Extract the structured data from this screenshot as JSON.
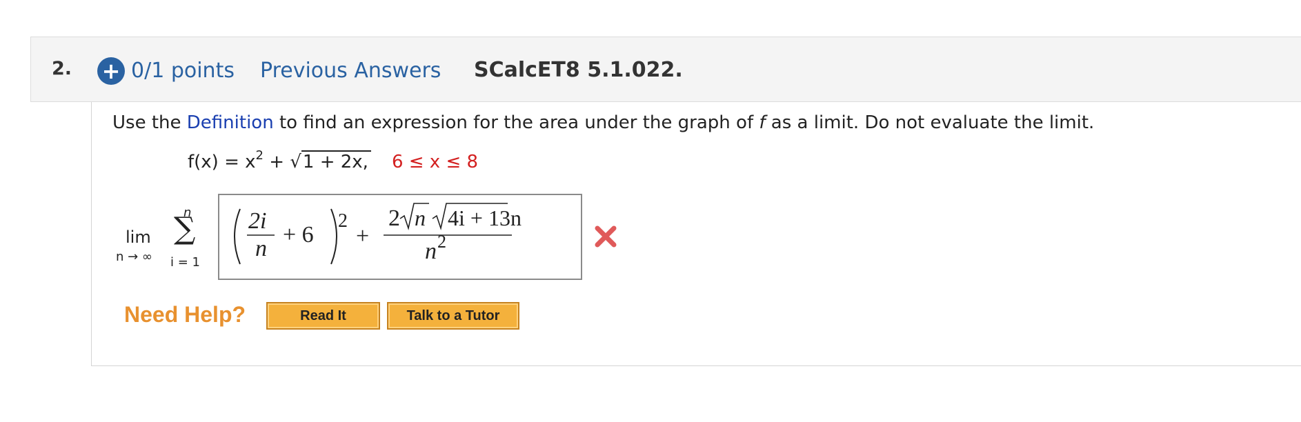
{
  "question": {
    "number": "2.",
    "points": "0/1 points",
    "previous_answers": "Previous Answers",
    "source": "SCalcET8 5.1.022."
  },
  "instruction": {
    "before_link": "Use the ",
    "link": "Definition",
    "after_link": " to find an expression for the area under the graph of ",
    "f": "f",
    "end": " as a limit. Do not evaluate the limit."
  },
  "function": {
    "lhs": "f(x) = x",
    "exponent": "2",
    "plus": " + ",
    "radicand": "1 + 2x,",
    "interval": "6 ≤ x ≤ 8"
  },
  "limit": {
    "lim": "lim",
    "sub": "n → ∞",
    "sigma_upper": "n",
    "sigma_lower": "i = 1"
  },
  "answer": {
    "frac1_num": "2i",
    "frac1_den": "n",
    "plus6": "+ 6",
    "square": "2",
    "plus": "+",
    "num_coef": "2",
    "num_n": "n",
    "num_radicand": "4i + 13n",
    "den_n": "n",
    "den_exp": "2",
    "status": "incorrect"
  },
  "help": {
    "label": "Need Help?",
    "read_it": "Read It",
    "talk_tutor": "Talk to a Tutor"
  },
  "colors": {
    "link_blue": "#2a62a2",
    "interval_red": "#d32020",
    "wrong_red": "#e05a5a",
    "help_orange": "#e8912f"
  }
}
